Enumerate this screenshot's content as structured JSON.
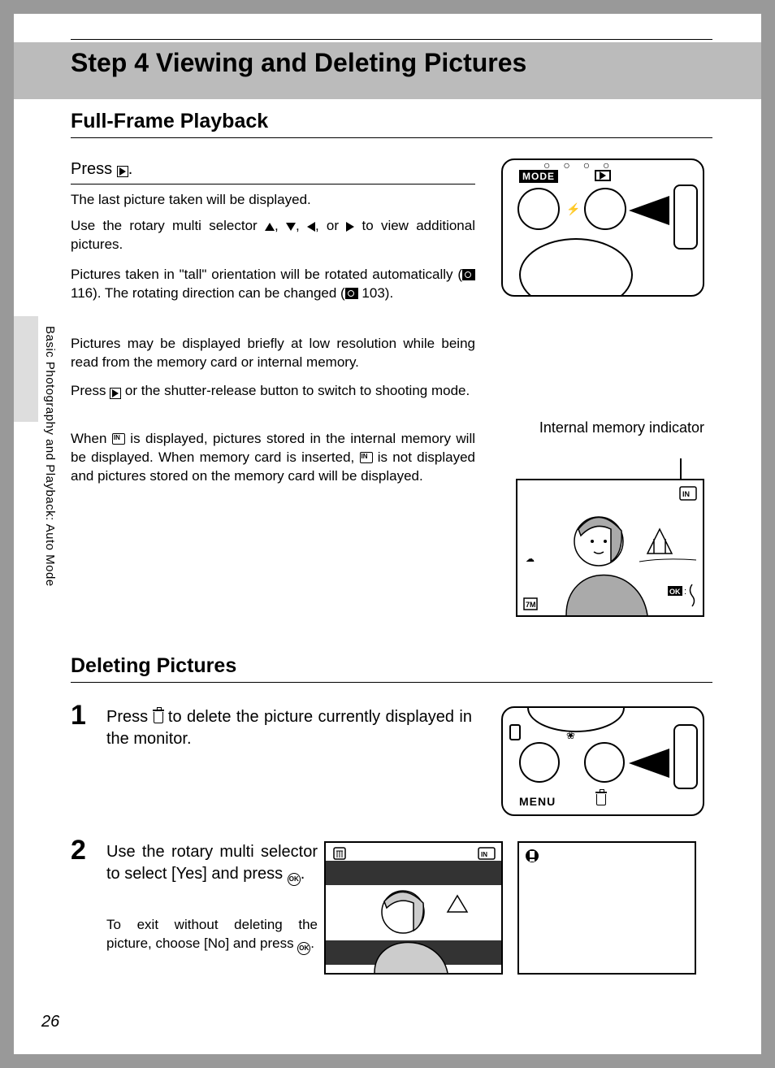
{
  "sidebar_tab": "Basic Photography and Playback: Auto Mode",
  "title": "Step 4 Viewing and Deleting Pictures",
  "section_fullframe": "Full-Frame Playback",
  "press_heading_pre": "Press ",
  "press_heading_post": ".",
  "para1": "The last picture taken will be displayed.",
  "para2_pre": "Use the rotary multi selector ",
  "para2_post": " to view additional pictures.",
  "para3_pre": "Pictures taken in \"tall\" orientation will be rotated automatically (",
  "para3_mid": " 116). The rotating direction can be changed (",
  "para3_post": " 103).",
  "para4": "Pictures may be displayed briefly at low resolution while being read from the memory card or internal memory.",
  "para5_pre": "Press ",
  "para5_post": " or the shutter-release button to switch to shooting mode.",
  "para6_pre": "When ",
  "para6_mid": " is displayed, pictures stored in the internal memory will be displayed. When memory card is inserted, ",
  "para6_post": " is not displayed and pictures stored on the memory card will be displayed.",
  "mem_indicator_label": "Internal memory indicator",
  "section_deleting": "Deleting Pictures",
  "step1_num": "1",
  "step1_pre": "Press ",
  "step1_post": " to delete the picture currently displayed in the monitor.",
  "step2_num": "2",
  "step2_head_pre": "Use the rotary multi selector to select [Yes] and press ",
  "step2_head_post": ".",
  "step2_body_pre": "To exit without deleting the picture, choose [No] and press ",
  "step2_body_post": ".",
  "diagram1": {
    "mode_label": "MODE"
  },
  "diagram2": {
    "menu_label": "MENU"
  },
  "page_number": "26"
}
